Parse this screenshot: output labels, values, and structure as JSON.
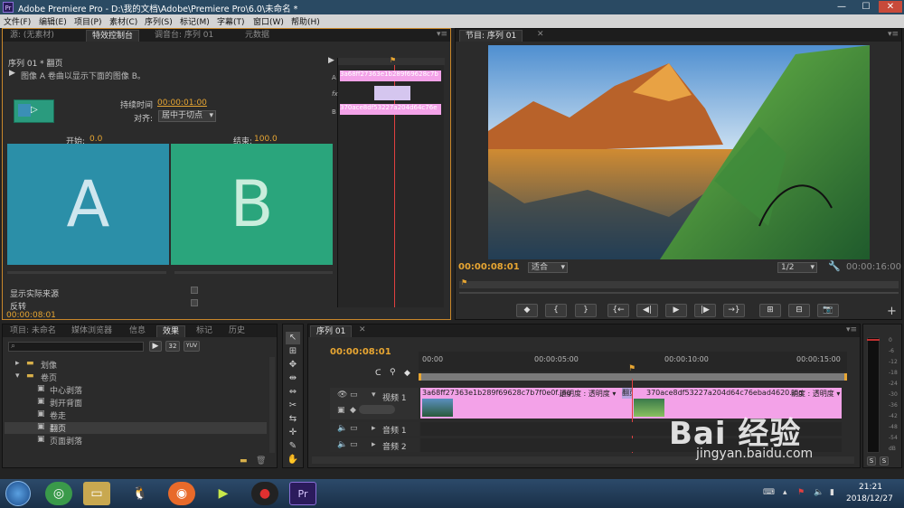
{
  "window": {
    "title": "Adobe Premiere Pro - D:\\我的文档\\Adobe\\Premiere Pro\\6.0\\未命名 *",
    "app_badge": "Pr",
    "minimize": "—",
    "maximize": "☐",
    "close": "✕"
  },
  "menu": [
    "文件(F)",
    "编辑(E)",
    "项目(P)",
    "素材(C)",
    "序列(S)",
    "标记(M)",
    "字幕(T)",
    "窗口(W)",
    "帮助(H)"
  ],
  "effect_panel": {
    "tabs": [
      "源: (无素材)",
      "特效控制台",
      "调音台: 序列 01",
      "元数据"
    ],
    "active_tab": 1,
    "sequence_label": "序列 01 * 翻页",
    "description": "图像 A 卷曲以显示下面的图像 B。",
    "duration_label": "持续时间",
    "duration_value": "00:00:01:00",
    "align_label": "对齐:",
    "align_value": "居中于切点",
    "start_label": "开始:",
    "start_value": "0.0",
    "end_label": "结束:",
    "end_value": "100.0",
    "preview_a": "A",
    "preview_b": "B",
    "show_actual_label": "显示实际来源",
    "reverse_label": "反转",
    "timecode": "00:00:08:01",
    "clip_a": "3a68ff27363e1b289f69628c7b",
    "clip_b": "370ace8df53227a204d64c76e",
    "row_a": "A",
    "row_b": "B"
  },
  "program": {
    "tab": "节目: 序列 01",
    "timecode_current": "00:00:08:01",
    "fit_label": "适合",
    "resolution": "1/2",
    "timecode_duration": "00:00:16:00",
    "transport": [
      "◆",
      "{",
      "}",
      "{←",
      "◀|",
      "▶",
      "|▶",
      "→}",
      "⊞",
      "⊟",
      "📷"
    ]
  },
  "project_panel": {
    "tabs": [
      "项目: 未命名",
      "媒体浏览器",
      "信息",
      "效果",
      "标记",
      "历史"
    ],
    "active_tab": 3,
    "badges": [
      "32",
      "YUV"
    ],
    "tree": [
      {
        "label": "划像",
        "type": "folder",
        "indent": 1
      },
      {
        "label": "卷页",
        "type": "folder",
        "indent": 1
      },
      {
        "label": "中心剥落",
        "type": "item",
        "indent": 2
      },
      {
        "label": "剥开背面",
        "type": "item",
        "indent": 2
      },
      {
        "label": "卷走",
        "type": "item",
        "indent": 2
      },
      {
        "label": "翻页",
        "type": "item",
        "indent": 2,
        "selected": true
      },
      {
        "label": "页面剥落",
        "type": "item",
        "indent": 2
      }
    ]
  },
  "tools": [
    "↖",
    "⊞",
    "✥",
    "⇹",
    "⇔",
    "✂",
    "⇆",
    "✛",
    "✎",
    "✋",
    "🔍"
  ],
  "timeline": {
    "tab": "序列 01",
    "timecode": "00:00:08:01",
    "ruler": [
      "00:00",
      "00:00:05:00",
      "00:00:10:00",
      "00:00:15:00"
    ],
    "tracks": [
      {
        "name": "视频 1",
        "type": "video"
      },
      {
        "name": "音频 1",
        "type": "audio"
      },
      {
        "name": "音频 2",
        "type": "audio"
      }
    ],
    "clip1": "3a68ff27363e1b289f69628c7b7f0e0f.jpg",
    "clip1_fx": "透明度 : 透明度 ▾",
    "transition": "翻页",
    "clip2": "370ace8df53227a204d64c76ebad4620.jpg",
    "clip2_fx": "明度 : 透明度 ▾"
  },
  "meter": {
    "labels": [
      "0",
      "-6",
      "-12",
      "-18",
      "-24",
      "-30",
      "-36",
      "-42",
      "-48",
      "-54",
      "dB"
    ],
    "solo": [
      "S",
      "S"
    ]
  },
  "taskbar": {
    "time": "21:21",
    "date": "2018/12/27",
    "pr_label": "Pr"
  },
  "watermark": {
    "text": "Bai 经验",
    "url": "jingyan.baidu.com"
  },
  "colors": {
    "accent_orange": "#e8a632",
    "clip_pink": "#f3a2e8",
    "a_teal": "#2b8fa8",
    "b_green": "#2aa57c"
  }
}
